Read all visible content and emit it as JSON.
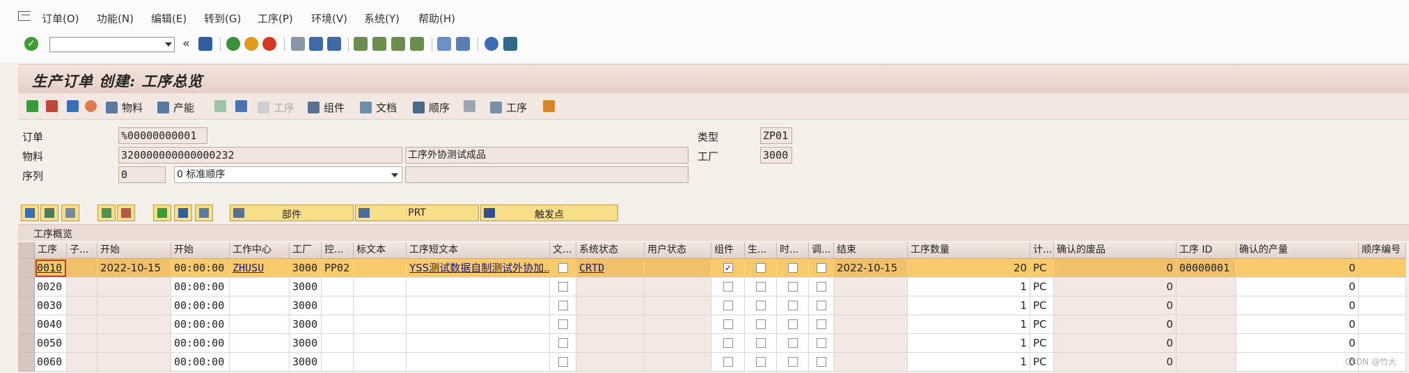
{
  "menu": {
    "items": [
      "订单(O)",
      "功能(N)",
      "编辑(E)",
      "转到(G)",
      "工序(P)",
      "环境(V)",
      "系统(Y)",
      "帮助(H)"
    ]
  },
  "toolbar": {
    "command_value": "",
    "back_glyph": "«",
    "ok_glyph": "✓"
  },
  "title": "生产订单 创建: 工序总览",
  "app_toolbar": {
    "material": "物料",
    "capacity": "产能",
    "operation_disabled": "工序",
    "component": "组件",
    "document": "文档",
    "sequence": "顺序",
    "operation": "工序"
  },
  "header": {
    "order_label": "订单",
    "order_value": "%00000000001",
    "material_label": "物料",
    "material_value": "320000000000000232",
    "material_desc": "工序外协测试成品",
    "sequence_label": "序列",
    "sequence_value": "0",
    "sequence_select": "0 标准顺序",
    "sequence_desc": "",
    "type_label": "类型",
    "type_value": "ZP01",
    "plant_label": "工厂",
    "plant_value": "3000"
  },
  "buttons": {
    "parts": "部件",
    "prt": "PRT",
    "trigger": "触发点"
  },
  "table": {
    "section_title": "工序概览",
    "columns": [
      "工序",
      "子...",
      "开始",
      "开始",
      "工作中心",
      "工厂",
      "控...",
      "标文本",
      "工序短文本",
      "文...",
      "系统状态",
      "用户状态",
      "组件",
      "生...",
      "时...",
      "调...",
      "结束",
      "工序数量",
      "计...",
      "确认的废品",
      "工序 ID",
      "确认的产量",
      "顺序编号"
    ],
    "rows": [
      {
        "op": "0010",
        "sub": "",
        "start_date": "2022-10-15",
        "start_time": "00:00:00",
        "wc": "ZHUSU",
        "plant": "3000",
        "ctrl": "PP02",
        "std": "",
        "short": "YSS测试数据自制测试外协加...",
        "doc": "",
        "sys": "CRTD",
        "user": "",
        "comp": true,
        "end_date": "2022-10-15",
        "qty": "20",
        "unit": "PC",
        "scrap": "0",
        "opid": "00000001",
        "yield": "0",
        "seq": ""
      },
      {
        "op": "0020",
        "sub": "",
        "start_date": "",
        "start_time": "00:00:00",
        "wc": "",
        "plant": "3000",
        "ctrl": "",
        "std": "",
        "short": "",
        "doc": "",
        "sys": "",
        "user": "",
        "comp": false,
        "end_date": "",
        "qty": "1",
        "unit": "PC",
        "scrap": "0",
        "opid": "",
        "yield": "0",
        "seq": ""
      },
      {
        "op": "0030",
        "sub": "",
        "start_date": "",
        "start_time": "00:00:00",
        "wc": "",
        "plant": "3000",
        "ctrl": "",
        "std": "",
        "short": "",
        "doc": "",
        "sys": "",
        "user": "",
        "comp": false,
        "end_date": "",
        "qty": "1",
        "unit": "PC",
        "scrap": "0",
        "opid": "",
        "yield": "0",
        "seq": ""
      },
      {
        "op": "0040",
        "sub": "",
        "start_date": "",
        "start_time": "00:00:00",
        "wc": "",
        "plant": "3000",
        "ctrl": "",
        "std": "",
        "short": "",
        "doc": "",
        "sys": "",
        "user": "",
        "comp": false,
        "end_date": "",
        "qty": "1",
        "unit": "PC",
        "scrap": "0",
        "opid": "",
        "yield": "0",
        "seq": ""
      },
      {
        "op": "0050",
        "sub": "",
        "start_date": "",
        "start_time": "00:00:00",
        "wc": "",
        "plant": "3000",
        "ctrl": "",
        "std": "",
        "short": "",
        "doc": "",
        "sys": "",
        "user": "",
        "comp": false,
        "end_date": "",
        "qty": "1",
        "unit": "PC",
        "scrap": "0",
        "opid": "",
        "yield": "0",
        "seq": ""
      },
      {
        "op": "0060",
        "sub": "",
        "start_date": "",
        "start_time": "00:00:00",
        "wc": "",
        "plant": "3000",
        "ctrl": "",
        "std": "",
        "short": "",
        "doc": "",
        "sys": "",
        "user": "",
        "comp": false,
        "end_date": "",
        "qty": "1",
        "unit": "PC",
        "scrap": "0",
        "opid": "",
        "yield": "0",
        "seq": ""
      }
    ]
  },
  "watermark": "CSDN @竹大"
}
